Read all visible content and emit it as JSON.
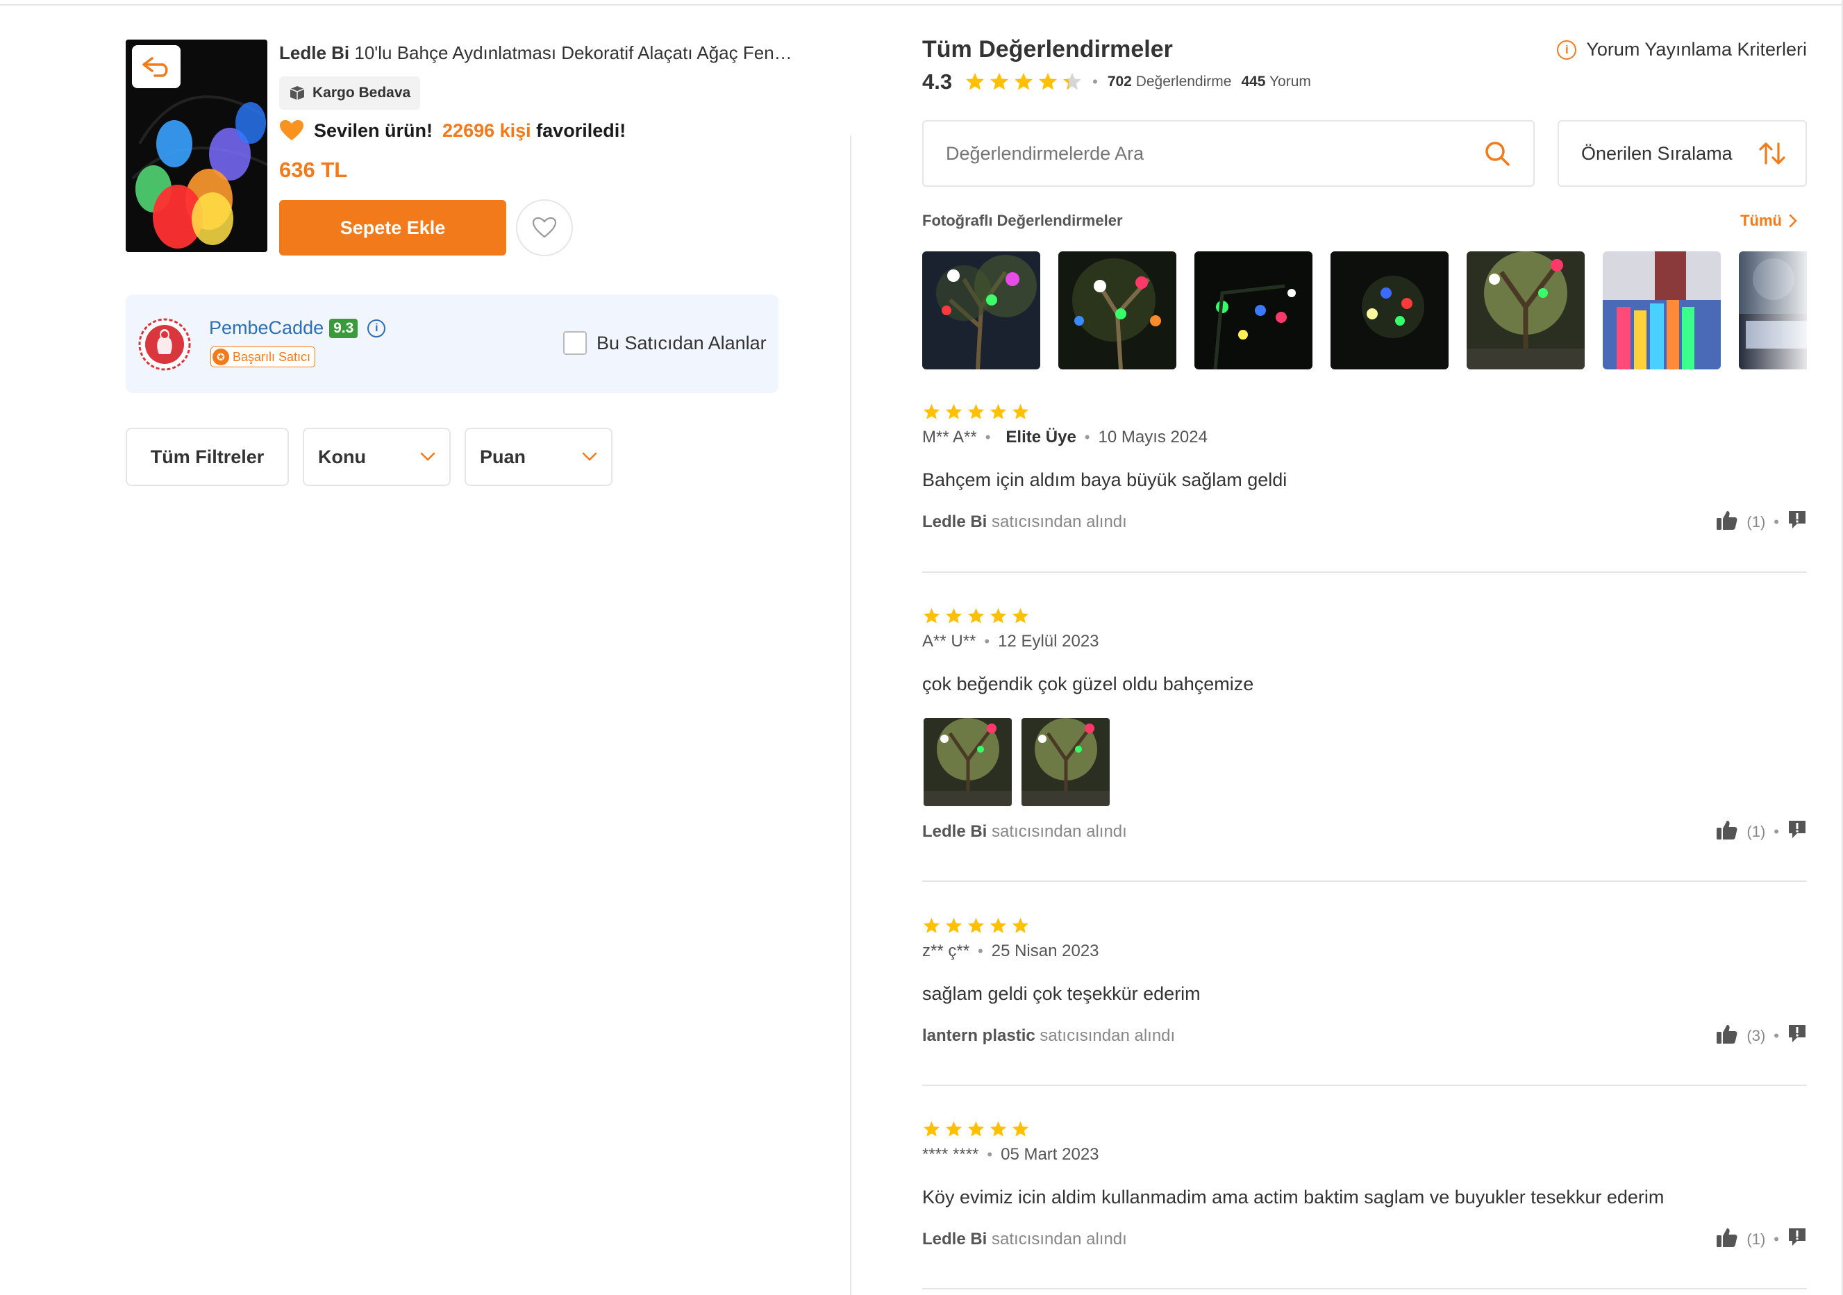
{
  "product": {
    "brand": "Ledle Bi",
    "title": "10'lu Bahçe Aydınlatması Dekoratif Alaçatı Ağaç Fene…",
    "kargo": "Kargo Bedava",
    "fav_prefix": "Sevilen ürün!",
    "fav_count": "22696 kişi",
    "fav_suffix": "favoriledi!",
    "price": "636 TL",
    "add_to_cart": "Sepete Ekle"
  },
  "seller": {
    "name": "PembeCadde",
    "score": "9.3",
    "badge": "Başarılı Satıcı",
    "filter_label": "Bu Satıcıdan Alanlar"
  },
  "filters": {
    "all": "Tüm Filtreler",
    "topic": "Konu",
    "rating": "Puan"
  },
  "reviews_header": {
    "title": "Tüm Değerlendirmeler",
    "criteria": "Yorum Yayınlama Kriterleri",
    "average": "4.3",
    "average_value": 4.3,
    "rating_count": "702",
    "rating_label": "Değerlendirme",
    "comment_count": "445",
    "comment_label": "Yorum",
    "search_placeholder": "Değerlendirmelerde Ara",
    "sort_label": "Önerilen Sıralama",
    "photo_title": "Fotoğraflı Değerlendirmeler",
    "photo_all": "Tümü"
  },
  "reviews": [
    {
      "stars": 5,
      "user": "M** A**",
      "elite": "Elite Üye",
      "date": "10 Mayıs 2024",
      "text": "Bahçem için aldım baya büyük sağlam geldi",
      "seller": "Ledle Bi",
      "seller_suffix": "satıcısından alındı",
      "likes": "(1)"
    },
    {
      "stars": 5,
      "user": "A** U**",
      "date": "12 Eylül 2023",
      "text": "çok beğendik çok güzel oldu bahçemize",
      "seller": "Ledle Bi",
      "seller_suffix": "satıcısından alındı",
      "likes": "(1)"
    },
    {
      "stars": 5,
      "user": "z** ç**",
      "date": "25 Nisan 2023",
      "text": "sağlam geldi çok teşekkür ederim",
      "seller": "lantern plastic",
      "seller_suffix": "satıcısından alındı",
      "likes": "(3)"
    },
    {
      "stars": 5,
      "user": "**** ****",
      "date": "05 Mart 2023",
      "text": "Köy evimiz icin aldim kullanmadim ama actim baktim saglam ve buyukler tesekkur ederim",
      "seller": "Ledle Bi",
      "seller_suffix": "satıcısından alındı",
      "likes": "(1)"
    }
  ],
  "colors": {
    "accent": "#f27a1a",
    "star": "#ffc000",
    "seller_blue": "#2d6fb6",
    "score_green": "#3a9b3a"
  },
  "icons": [
    "back-icon",
    "box-icon",
    "heart-emoji-icon",
    "heart-outline-icon",
    "info-icon",
    "search-icon",
    "sort-icon",
    "chevron-down-icon",
    "chevron-right-icon",
    "star-icon",
    "thumbs-up-icon",
    "report-icon"
  ]
}
